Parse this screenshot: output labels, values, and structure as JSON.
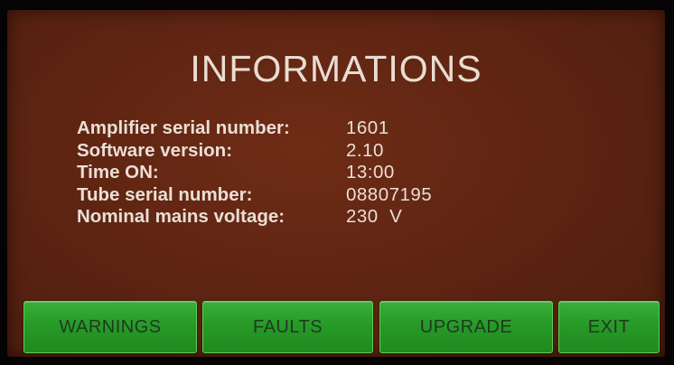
{
  "title": "INFORMATIONS",
  "info": [
    {
      "label": "Amplifier serial number:",
      "value": "1601"
    },
    {
      "label": "Software version:",
      "value": "2.10"
    },
    {
      "label": "Time ON:",
      "value": "13:00"
    },
    {
      "label": "Tube serial number:",
      "value": "08807195"
    },
    {
      "label": "Nominal mains voltage:",
      "value": "230  V"
    }
  ],
  "buttons": {
    "warnings": "WARNINGS",
    "faults": "FAULTS",
    "upgrade": "UPGRADE",
    "exit": "EXIT"
  },
  "colors": {
    "background": "#5f2512",
    "button": "#279a27",
    "text": "#eadfd6"
  }
}
